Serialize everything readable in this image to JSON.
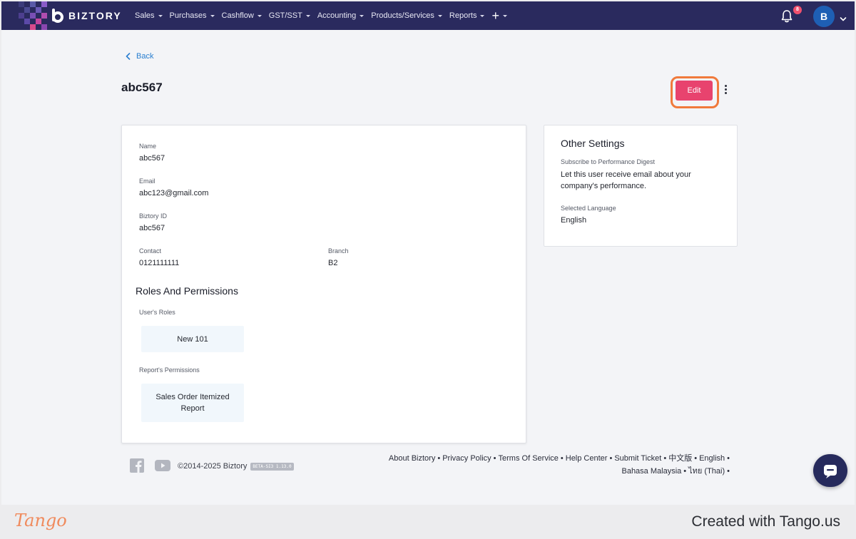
{
  "nav": {
    "brand": "BIZTORY",
    "menu": [
      {
        "label": "Sales"
      },
      {
        "label": "Purchases"
      },
      {
        "label": "Cashflow"
      },
      {
        "label": "GST/SST"
      },
      {
        "label": "Accounting"
      },
      {
        "label": "Products/Services"
      },
      {
        "label": "Reports"
      }
    ],
    "add_label": "+",
    "notification_count": "8",
    "avatar_initial": "B",
    "colors": {
      "bar": "#2a2a5e",
      "badge": "#f0506e",
      "avatar": "#1e5fb4"
    }
  },
  "page": {
    "back_label": "Back",
    "title": "abc567",
    "edit_label": "Edit"
  },
  "details": {
    "name_label": "Name",
    "name_value": "abc567",
    "email_label": "Email",
    "email_value": "abc123@gmail.com",
    "biztory_id_label": "Biztory ID",
    "biztory_id_value": "abc567",
    "contact_label": "Contact",
    "contact_value": "0121111111",
    "branch_label": "Branch",
    "branch_value": "B2"
  },
  "roles": {
    "section_title": "Roles And Permissions",
    "users_roles_label": "User's Roles",
    "users_roles": [
      "New 101"
    ],
    "report_permissions_label": "Report's Permissions",
    "report_permissions": [
      "Sales Order Itemized Report"
    ]
  },
  "other_settings": {
    "title": "Other Settings",
    "digest_label": "Subscribe to Performance Digest",
    "digest_value": "Let this user receive email about your company's performance.",
    "language_label": "Selected Language",
    "language_value": "English"
  },
  "footer": {
    "copyright": "©2014-2025 Biztory",
    "version_badge": "BETA-SI3 1.13.0",
    "links_line1": [
      "About Biztory",
      "Privacy Policy",
      "Terms Of Service",
      "Help Center",
      "Submit Ticket",
      "中文版",
      "English"
    ],
    "links_line2": [
      "Bahasa Malaysia",
      "ไทย (Thai)"
    ]
  },
  "tango": {
    "logo": "Tango",
    "created": "Created with Tango.us"
  },
  "icons": [
    "facebook-icon",
    "youtube-icon",
    "bell-icon",
    "chevron-left-icon",
    "kebab-menu-icon",
    "chat-icon",
    "chevron-down-icon"
  ]
}
